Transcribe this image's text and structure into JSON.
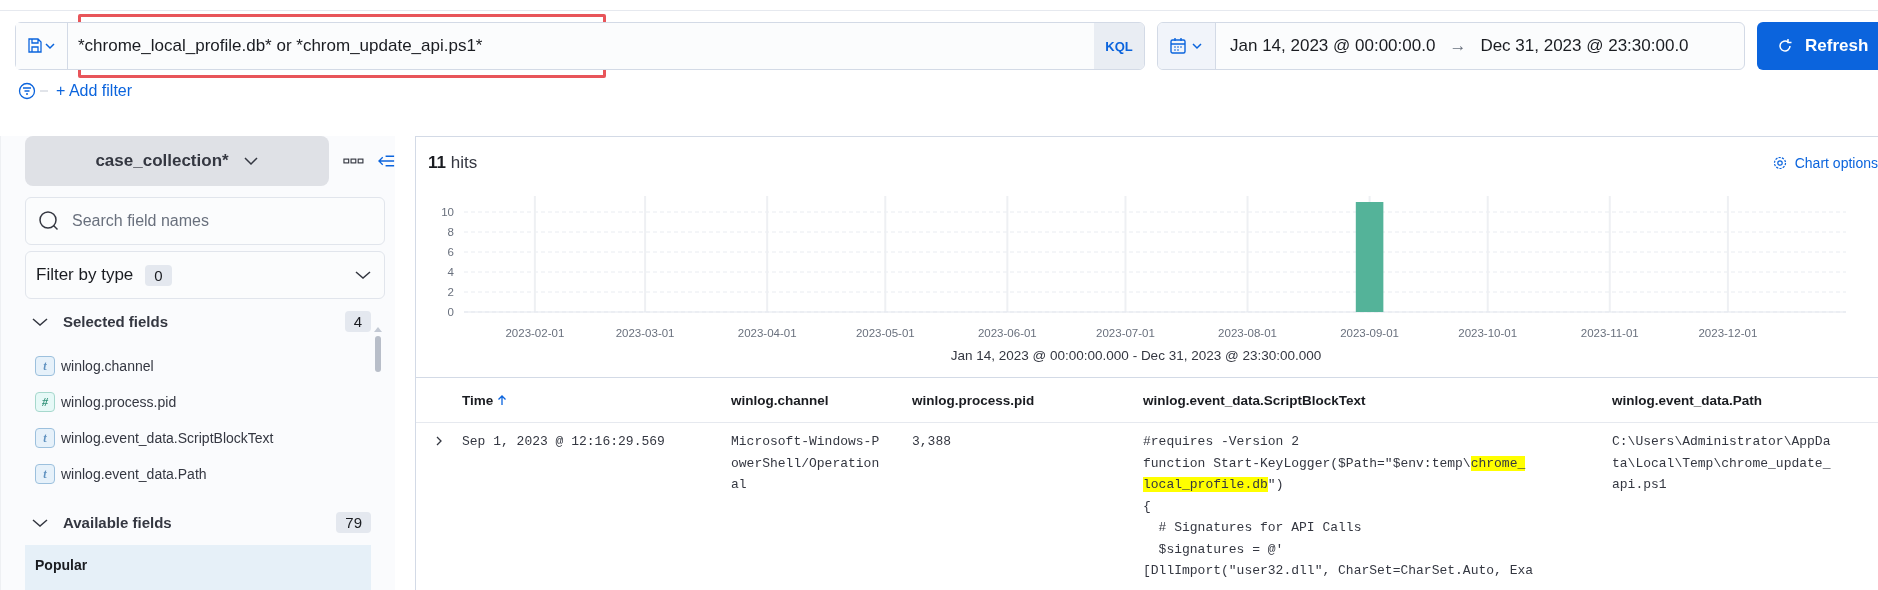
{
  "query_bar": {
    "value": "*chrome_local_profile.db* or *chrom_update_api.ps1*",
    "language": "KQL",
    "highlighted": true
  },
  "date_picker": {
    "start": "Jan 14, 2023 @ 00:00:00.0",
    "arrow": "→",
    "end": "Dec 31, 2023 @ 23:30:00.0"
  },
  "refresh_button": {
    "label": "Refresh"
  },
  "add_filter": {
    "label": "+ Add filter"
  },
  "sidebar": {
    "index_pattern": "case_collection*",
    "search": {
      "placeholder": "Search field names"
    },
    "filter_by_type": {
      "label": "Filter by type",
      "count": "0"
    },
    "sections": [
      {
        "title": "Selected fields",
        "count": "4",
        "expanded": true,
        "fields": [
          {
            "kind": "string",
            "icon": "t",
            "name": "winlog.channel"
          },
          {
            "kind": "number",
            "icon": "#",
            "name": "winlog.process.pid"
          },
          {
            "kind": "string",
            "icon": "t",
            "name": "winlog.event_data.ScriptBlockText"
          },
          {
            "kind": "string",
            "icon": "t",
            "name": "winlog.event_data.Path"
          }
        ]
      },
      {
        "title": "Available fields",
        "count": "79",
        "expanded": true,
        "groups": [
          {
            "title": "Popular"
          }
        ]
      }
    ]
  },
  "results": {
    "count": "11",
    "label": "hits",
    "chart_options": "Chart options",
    "time_range": "Jan 14, 2023 @ 00:00:00.000 - Dec 31, 2023 @ 23:30:00.000",
    "chart_data": {
      "type": "bar",
      "grid": true,
      "x": [
        "2023-09-01"
      ],
      "series": [
        {
          "color": "#54b399",
          "values": [
            11
          ]
        }
      ],
      "xlim": [
        "2023-01-14",
        "2023-12-31"
      ],
      "ylim": [
        0,
        11
      ],
      "xticks": [
        {
          "value": "2023-02-01",
          "label": "2023-02-01"
        },
        {
          "value": "2023-03-01",
          "label": "2023-03-01"
        },
        {
          "value": "2023-04-01",
          "label": "2023-04-01"
        },
        {
          "value": "2023-05-01",
          "label": "2023-05-01"
        },
        {
          "value": "2023-06-01",
          "label": "2023-06-01"
        },
        {
          "value": "2023-07-01",
          "label": "2023-07-01"
        },
        {
          "value": "2023-08-01",
          "label": "2023-08-01"
        },
        {
          "value": "2023-09-01",
          "label": "2023-09-01"
        },
        {
          "value": "2023-10-01",
          "label": "2023-10-01"
        },
        {
          "value": "2023-11-01",
          "label": "2023-11-01"
        },
        {
          "value": "2023-12-01",
          "label": "2023-12-01"
        }
      ],
      "yticks": [
        0,
        2,
        4,
        6,
        8,
        10
      ]
    }
  },
  "table": {
    "columns": [
      {
        "label": "Time",
        "sorted": true
      },
      {
        "label": "winlog.channel",
        "sorted": false
      },
      {
        "label": "winlog.process.pid",
        "sorted": false
      },
      {
        "label": "winlog.event_data.ScriptBlockText",
        "sorted": false
      },
      {
        "label": "winlog.event_data.Path",
        "sorted": false
      }
    ],
    "rows": [
      {
        "expanded": false,
        "time": "Sep 1, 2023 @ 12:16:29.569",
        "channel": "Microsoft-Windows-PowerShell/Operational",
        "pid": "3,388",
        "script_lines": [
          [
            {
              "text": "#requires -Version 2",
              "highlight": false
            }
          ],
          [
            {
              "text": "function Start-KeyLogger($Path=\"$env:temp\\",
              "highlight": false
            },
            {
              "text": "chrome_",
              "highlight": true
            }
          ],
          [
            {
              "text": "local_profile.db",
              "highlight": true
            },
            {
              "text": "\")",
              "highlight": false
            }
          ],
          [
            {
              "text": "{",
              "highlight": false
            }
          ],
          [
            {
              "text": "  # Signatures for API Calls",
              "highlight": false
            }
          ],
          [
            {
              "text": "  $signatures = @'",
              "highlight": false
            }
          ],
          [
            {
              "text": "[DllImport(\"user32.dll\", CharSet=CharSet.Auto, Exa",
              "highlight": false
            }
          ]
        ],
        "path": "C:\\Users\\Administrator\\AppData\\Local\\Temp\\chrome_update_api.ps1"
      }
    ]
  }
}
